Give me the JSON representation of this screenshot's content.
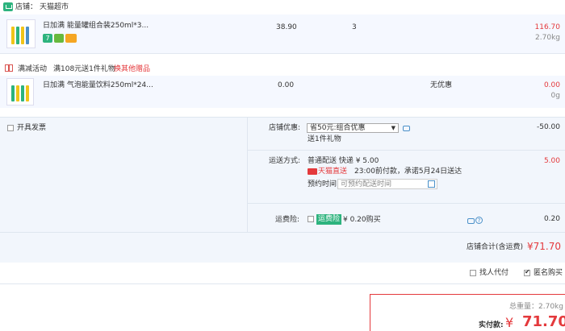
{
  "shop": {
    "label": "店铺：",
    "name": "天猫超市"
  },
  "item1": {
    "title": "日加满 能量罐组合装250ml*3...",
    "price": "38.90",
    "qty": "3",
    "subtotal": "116.70",
    "weight": "2.70kg"
  },
  "promo": {
    "label": "满减活动",
    "desc": "满108元送1件礼物",
    "link": "换其他赠品"
  },
  "item2": {
    "title": "日加满 气泡能量饮料250ml*24...",
    "price": "0.00",
    "discount": "无优惠",
    "subtotal": "0.00",
    "weight": "0g"
  },
  "invoice": {
    "label": "开具发票"
  },
  "coupon": {
    "label": "店铺优惠:",
    "selected": "省50元:组合优惠",
    "gift": "送1件礼物",
    "amount": "-50.00"
  },
  "shipping": {
    "label": "运送方式:",
    "method": "普通配送 快递 ¥ 5.00",
    "brand": "天猫直送",
    "note": "23:00前付款，承诺5月24日送达",
    "appt_label": "预约时间",
    "appt_placeholder": "可预约配送时间",
    "amount": "5.00"
  },
  "insurance": {
    "label": "运费险:",
    "badge": "运费险",
    "price": "¥ 0.20购买",
    "amount": "0.20"
  },
  "shop_total": {
    "label": "店铺合计(含运费)",
    "amount": "¥71.70"
  },
  "options": {
    "proxy": "找人代付",
    "anon": "匿名购买"
  },
  "summary": {
    "weight_label": "总重量：",
    "weight": "2.70kg",
    "pay_label": "实付款:",
    "currency": "¥",
    "amount": "71.70"
  },
  "colors": {
    "accent": "#e4393c",
    "brand_green": "#2db37e",
    "panel_bg": "#f2f6fc"
  }
}
